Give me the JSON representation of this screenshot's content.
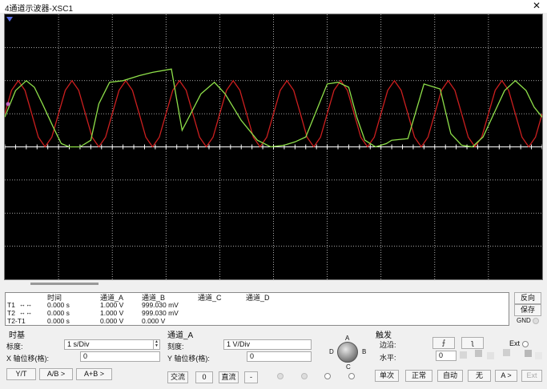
{
  "window": {
    "title": "4通道示波器-XSC1",
    "close_glyph": "✕"
  },
  "readout": {
    "headers": {
      "time": "时间",
      "a": "通道_A",
      "b": "通道_B",
      "c": "通道_C",
      "d": "通道_D"
    },
    "rows": [
      {
        "label": "T1",
        "arrows": "↔ ↔",
        "time": "0.000 s",
        "a": "1.000 V",
        "b": "999.030 mV"
      },
      {
        "label": "T2",
        "arrows": "↔ ↔",
        "time": "0.000 s",
        "a": "1.000 V",
        "b": "999.030 mV"
      },
      {
        "label": "T2-T1",
        "arrows": "",
        "time": "0.000 s",
        "a": "0.000 V",
        "b": "0.000 V"
      }
    ],
    "buttons": {
      "reverse": "反向",
      "save": "保存"
    },
    "gnd_label": "GND"
  },
  "timebase": {
    "title": "时基",
    "scale_label": "标度:",
    "scale_value": "1 s/Div",
    "xpos_label": "X 轴位移(格):",
    "xpos_value": "0",
    "buttons": {
      "yt": "Y/T",
      "ab": "A/B >",
      "aplusb": "A+B >"
    }
  },
  "channel": {
    "title": "通道_A",
    "scale_label": "刻度:",
    "scale_value": "1 V/Div",
    "ypos_label": "Y 轴位移(格):",
    "ypos_value": "0",
    "coupling": {
      "ac": "交流",
      "zero": "0",
      "dc": "直流",
      "minus": "-"
    },
    "knob_labels": {
      "a": "A",
      "b": "B",
      "c": "C",
      "d": "D"
    }
  },
  "trigger": {
    "title": "触发",
    "edge_label": "边沿:",
    "edge_rise": "⨍",
    "edge_fall": "ʅ",
    "ext_label": "Ext",
    "level_label": "水平:",
    "level_value": "0",
    "mode_buttons": {
      "single": "单次",
      "normal": "正常",
      "auto": "自动",
      "none": "无",
      "a": "A >",
      "ext": "Ext"
    }
  },
  "colors": {
    "channel_a": "#cc1f1f",
    "channel_b": "#8fe04a",
    "grid": "#d8d8d8",
    "screen": "#000000"
  },
  "chart_data": {
    "type": "line",
    "title": "",
    "xlabel": "",
    "ylabel": "",
    "xlim": [
      0,
      10
    ],
    "ylim": [
      -4,
      4
    ],
    "grid": true,
    "series": [
      {
        "name": "",
        "color": "#cc1f1f",
        "x": [
          0,
          0.125,
          0.25,
          0.375,
          0.5,
          0.625,
          0.75,
          0.875,
          1.0,
          1.125,
          1.25,
          1.375,
          1.5,
          1.625,
          1.75,
          1.875,
          2.0,
          2.125,
          2.25,
          2.375,
          2.5,
          2.625,
          2.75,
          2.875,
          3.0,
          3.125,
          3.25,
          3.375,
          3.5,
          3.625,
          3.75,
          3.875,
          4.0,
          4.125,
          4.25,
          4.375,
          4.5,
          4.625,
          4.75,
          4.875,
          5.0,
          5.125,
          5.25,
          5.375,
          5.5,
          5.625,
          5.75,
          5.875,
          6.0,
          6.125,
          6.25,
          6.375,
          6.5,
          6.625,
          6.75,
          6.875,
          7.0,
          7.125,
          7.25,
          7.375,
          7.5,
          7.625,
          7.75,
          7.875,
          8.0,
          8.125,
          8.25,
          8.375,
          8.5,
          8.625,
          8.75,
          8.875,
          9.0,
          9.125,
          9.25,
          9.375,
          9.5,
          9.625,
          9.75,
          9.875,
          10.0
        ],
        "y": [
          1.0,
          1.707,
          2.0,
          1.707,
          1.0,
          0.293,
          0.0,
          0.293,
          1.0,
          1.707,
          2.0,
          1.707,
          1.0,
          0.293,
          0.0,
          0.293,
          1.0,
          1.707,
          2.0,
          1.707,
          1.0,
          0.293,
          0.0,
          0.293,
          1.0,
          1.707,
          2.0,
          1.707,
          1.0,
          0.293,
          0.0,
          0.293,
          1.0,
          1.707,
          2.0,
          1.707,
          1.0,
          0.293,
          0.0,
          0.293,
          1.0,
          1.707,
          2.0,
          1.707,
          1.0,
          0.293,
          0.0,
          0.293,
          1.0,
          1.707,
          2.0,
          1.707,
          1.0,
          0.293,
          0.0,
          0.293,
          1.0,
          1.707,
          2.0,
          1.707,
          1.0,
          0.293,
          0.0,
          0.293,
          1.0,
          1.707,
          2.0,
          1.707,
          1.0,
          0.293,
          0.0,
          0.293,
          1.0,
          1.707,
          2.0,
          1.707,
          1.0,
          0.293,
          0.0,
          0.293,
          1.0
        ]
      },
      {
        "name": "",
        "color": "#8fe04a",
        "x": [
          0.0,
          0.2,
          0.4,
          0.55,
          0.7,
          0.9,
          1.05,
          1.2,
          1.4,
          1.6,
          1.75,
          1.95,
          2.2,
          2.5,
          2.75,
          3.1,
          3.3,
          3.65,
          3.9,
          4.1,
          4.4,
          4.7,
          4.95,
          5.2,
          5.4,
          5.6,
          6.0,
          6.2,
          6.4,
          6.55,
          6.7,
          6.9,
          7.1,
          7.2,
          7.5,
          7.8,
          8.1,
          8.3,
          8.5,
          8.7,
          8.9,
          9.1,
          9.3,
          9.5,
          9.7,
          9.85,
          10.0
        ],
        "y": [
          0.9,
          1.7,
          2.0,
          1.8,
          1.3,
          0.6,
          0.1,
          0.0,
          0.0,
          0.2,
          1.3,
          1.95,
          2.0,
          2.15,
          2.25,
          2.35,
          0.5,
          1.6,
          1.95,
          1.6,
          0.8,
          0.2,
          0.0,
          0.05,
          0.15,
          0.3,
          1.9,
          1.95,
          1.8,
          0.9,
          0.2,
          0.0,
          0.1,
          0.2,
          0.25,
          1.9,
          1.75,
          0.4,
          0.05,
          0.0,
          0.3,
          1.0,
          1.7,
          2.0,
          1.7,
          1.2,
          0.9
        ]
      }
    ]
  }
}
